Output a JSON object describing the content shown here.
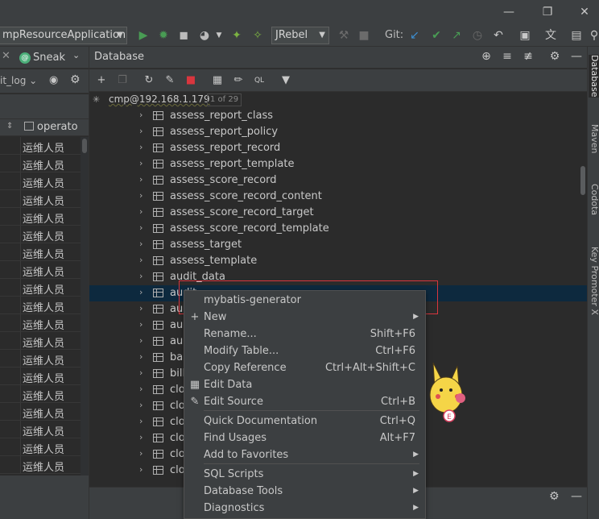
{
  "toolbar": {
    "run_config": "mpResourceApplication",
    "jrebel": "JRebel",
    "git_label": "Git:"
  },
  "left_panel": {
    "tab_label": "Sneak",
    "selector": "it_log",
    "column_header": "operato",
    "rows": [
      "运维人员",
      "运维人员",
      "运维人员",
      "运维人员",
      "运维人员",
      "运维人员",
      "运维人员",
      "运维人员",
      "运维人员",
      "运维人员",
      "运维人员",
      "运维人员",
      "运维人员",
      "运维人员",
      "运维人员",
      "运维人员",
      "运维人员",
      "运维人员",
      "运维人员"
    ]
  },
  "database_panel": {
    "title": "Database",
    "connection": "cmp@192.168.1.179",
    "connection_count": "1 of 29",
    "tables": [
      "assess_report_class",
      "assess_report_policy",
      "assess_report_record",
      "assess_report_template",
      "assess_score_record",
      "assess_score_record_content",
      "assess_score_record_target",
      "assess_score_record_template",
      "assess_target",
      "assess_template",
      "audit_data",
      "audit",
      "aud",
      "aud",
      "aud",
      "bas",
      "bill",
      "clo",
      "clo",
      "clo",
      "clo",
      "clo",
      "clo"
    ]
  },
  "right_tabs": [
    "Database",
    "Maven",
    "Codota",
    "Key Promoter X"
  ],
  "context_menu": {
    "items": [
      {
        "label": "mybatis-generator",
        "shortcut": ""
      },
      {
        "label": "New",
        "shortcut": ""
      },
      {
        "label": "Rename...",
        "shortcut": "Shift+F6"
      },
      {
        "label": "Modify Table...",
        "shortcut": "Ctrl+F6"
      },
      {
        "label": "Copy Reference",
        "shortcut": "Ctrl+Alt+Shift+C"
      },
      {
        "label": "Edit Data",
        "shortcut": ""
      },
      {
        "label": "Edit Source",
        "shortcut": "Ctrl+B"
      },
      {
        "label": "Quick Documentation",
        "shortcut": "Ctrl+Q"
      },
      {
        "label": "Find Usages",
        "shortcut": "Alt+F7"
      },
      {
        "label": "Add to Favorites",
        "shortcut": ""
      },
      {
        "label": "SQL Scripts",
        "shortcut": ""
      },
      {
        "label": "Database Tools",
        "shortcut": ""
      },
      {
        "label": "Diagnostics",
        "shortcut": ""
      }
    ]
  },
  "colors": {
    "background": "#2b2b2b",
    "panel": "#3c3f41",
    "selection": "#0d293e",
    "highlight_border": "#d9363e",
    "run_green": "#499c54"
  }
}
